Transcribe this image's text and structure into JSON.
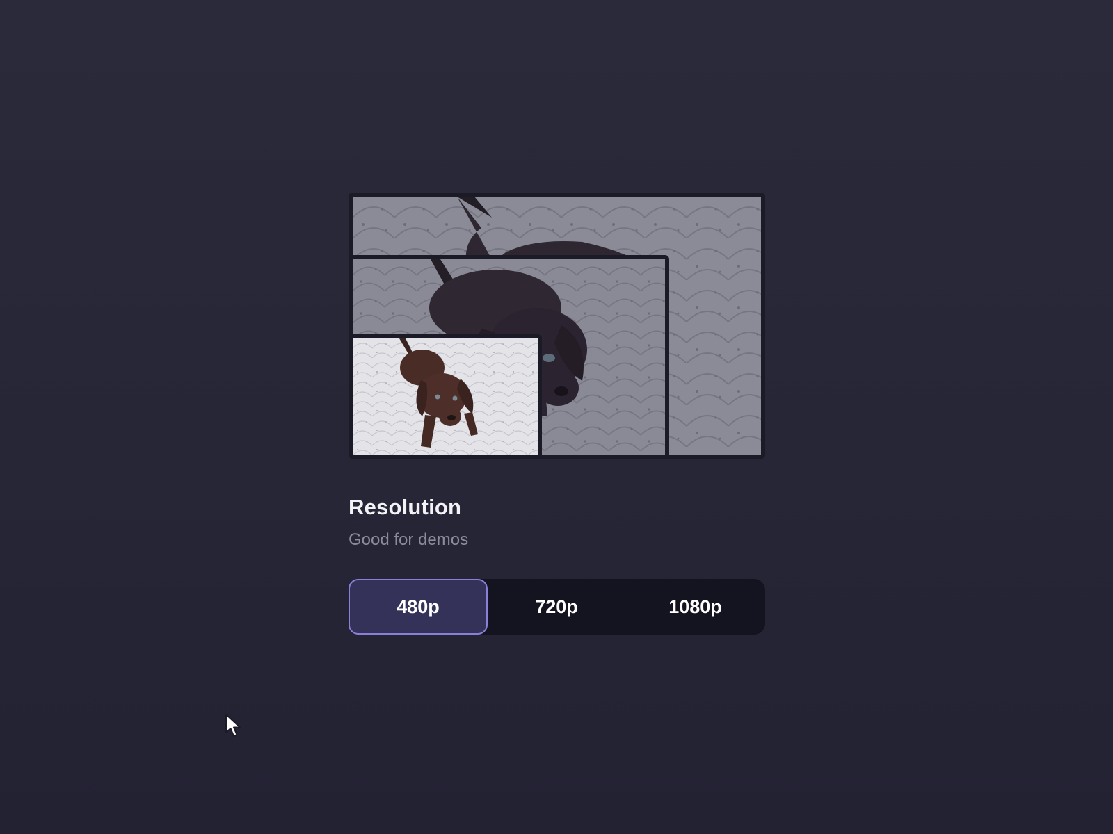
{
  "setting": {
    "title": "Resolution",
    "subtitle": "Good for demos"
  },
  "resolution_options": [
    {
      "label": "480p",
      "selected": true
    },
    {
      "label": "720p",
      "selected": false
    },
    {
      "label": "1080p",
      "selected": false
    }
  ],
  "preview": {
    "subject": "puppy-photo",
    "frames": [
      "1080p",
      "720p",
      "480p"
    ]
  },
  "colors": {
    "background": "#272637",
    "selected_fill": "#35325a",
    "selected_border": "#8a80d8",
    "control_track": "#141320",
    "text_primary": "#f3f3f6",
    "text_secondary": "#8d8c9c"
  }
}
